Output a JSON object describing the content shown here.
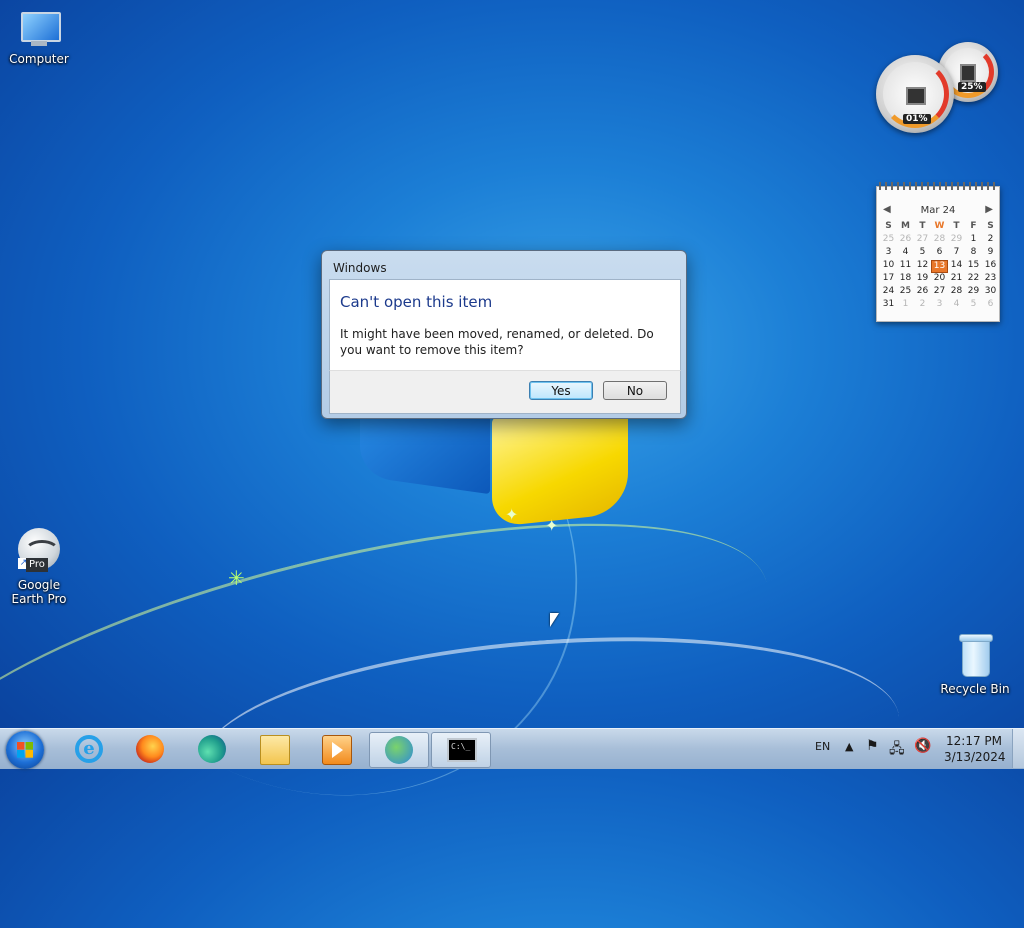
{
  "desktop": {
    "icons": {
      "computer": "Computer",
      "google_earth": "Google Earth Pro",
      "google_earth_badge": "Pro",
      "recycle_bin": "Recycle Bin"
    }
  },
  "gadgets": {
    "cpu_meter": {
      "cpu_percent": "01%",
      "memory_percent": "25%"
    },
    "calendar": {
      "month_label": "Mar 24",
      "weekday_headers": [
        "S",
        "M",
        "T",
        "W",
        "T",
        "F",
        "S"
      ],
      "highlight_weekday_index": 3,
      "weeks": [
        [
          "25",
          "26",
          "27",
          "28",
          "29",
          "1",
          "2"
        ],
        [
          "3",
          "4",
          "5",
          "6",
          "7",
          "8",
          "9"
        ],
        [
          "10",
          "11",
          "12",
          "13",
          "14",
          "15",
          "16"
        ],
        [
          "17",
          "18",
          "19",
          "20",
          "21",
          "22",
          "23"
        ],
        [
          "24",
          "25",
          "26",
          "27",
          "28",
          "29",
          "30"
        ],
        [
          "31",
          "1",
          "2",
          "3",
          "4",
          "5",
          "6"
        ]
      ],
      "today": "13"
    }
  },
  "dialog": {
    "window_title": "Windows",
    "heading": "Can't open this item",
    "message": "It might have been moved, renamed, or deleted. Do you want to remove this item?",
    "yes_label": "Yes",
    "no_label": "No"
  },
  "taskbar": {
    "pinned": [
      "internet-explorer-icon",
      "firefox-icon",
      "edge-icon",
      "file-explorer-icon",
      "media-player-icon",
      "people-icon",
      "command-prompt-icon"
    ],
    "language": "EN",
    "time": "12:17 PM",
    "date": "3/13/2024"
  }
}
